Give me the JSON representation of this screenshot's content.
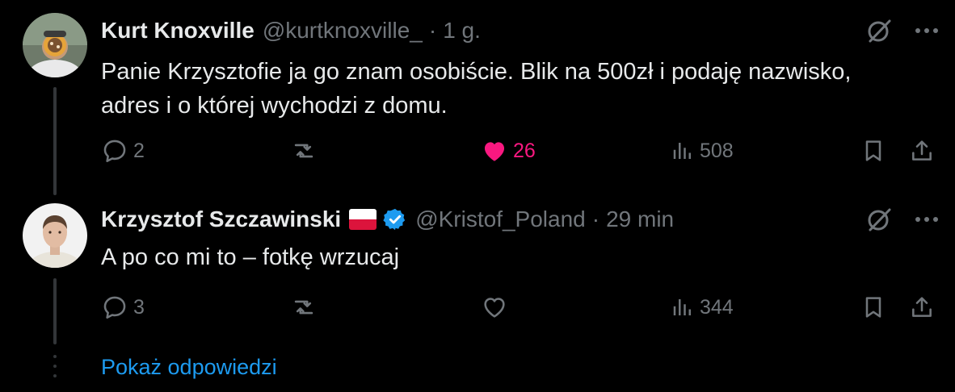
{
  "tweets": [
    {
      "name": "Kurt Knoxville",
      "handle": "@kurtknoxville_",
      "separator": "·",
      "time": "1 g.",
      "text": "Panie Krzysztofie ja go znam osobiście. Blik na 500zł i podaję nazwisko,\nadres i o której wychodzi z domu.",
      "replies": "2",
      "reposts": "",
      "likes": "26",
      "views": "508",
      "liked": true
    },
    {
      "name": "Krzysztof Szczawinski",
      "flag": "poland-flag",
      "verified": "verified-badge",
      "handle": "@Kristof_Poland",
      "separator": "·",
      "time": "29 min",
      "text": "A po co mi to – fotkę wrzucaj",
      "replies": "3",
      "reposts": "",
      "likes": "",
      "views": "344",
      "liked": false
    }
  ],
  "show_replies": "Pokaż odpowiedzi",
  "colors": {
    "background": "#000000",
    "text": "#e7e9ea",
    "muted": "#71767b",
    "like": "#f91880",
    "link": "#1d9bf0",
    "verified": "#1d9bf0"
  }
}
